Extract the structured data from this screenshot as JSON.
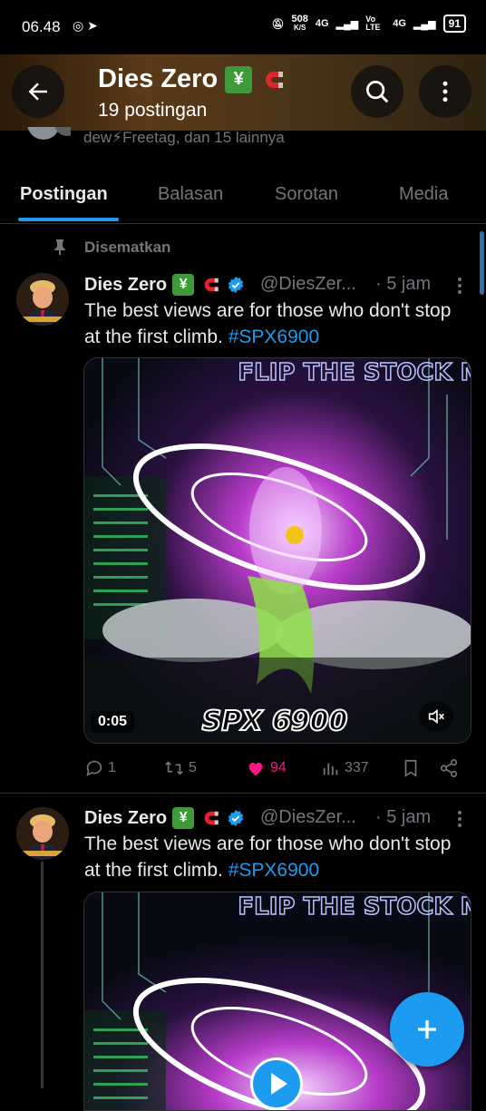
{
  "status_bar": {
    "time": "06.48",
    "speed": "508",
    "speed_unit": "K/S",
    "net1": "4G",
    "volte": "Vo LTE",
    "net2": "4G",
    "battery": "91"
  },
  "header": {
    "title": "Dies Zero",
    "badge_glyph": "¥",
    "posts_count": "19 postingan",
    "followed_by": "dew⚡Freetag, dan 15 lainnya"
  },
  "tabs": [
    {
      "label": "Postingan",
      "active": true
    },
    {
      "label": "Balasan"
    },
    {
      "label": "Sorotan"
    },
    {
      "label": "Media"
    }
  ],
  "pinned_label": "Disematkan",
  "tweets": [
    {
      "name": "Dies Zero",
      "handle": "@DiesZer...",
      "time": "· 5 jam",
      "text_main": "The best views are for those who don't stop at the first climb. ",
      "hashtag": "#SPX6900",
      "media_title": "FLIP THE STOCK MAR",
      "media_caption": "SPX 6900",
      "video_time": "0:05",
      "replies": "1",
      "retweets": "5",
      "likes": "94",
      "views": "337"
    },
    {
      "name": "Dies Zero",
      "handle": "@DiesZer...",
      "time": "· 5 jam",
      "text_main": "The best views are for those who don't stop at the first climb. ",
      "hashtag": "#SPX6900",
      "media_title": "FLIP THE STOCK MAR"
    }
  ],
  "colors": {
    "accent": "#1d9bf0",
    "like": "#f91880",
    "muted": "#71767b",
    "verified": "#1d9bf0"
  }
}
